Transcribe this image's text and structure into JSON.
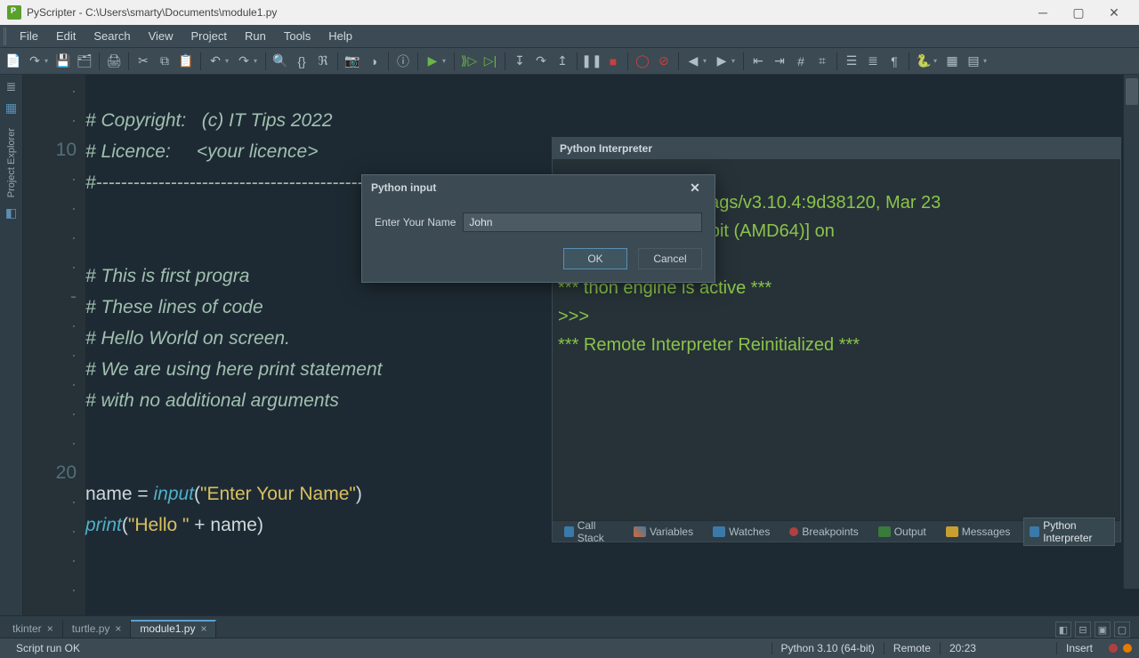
{
  "title": "PyScripter - C:\\Users\\smarty\\Documents\\module1.py",
  "menu": [
    "File",
    "Edit",
    "Search",
    "View",
    "Project",
    "Run",
    "Tools",
    "Help"
  ],
  "gutter": [
    "·",
    "·",
    "10",
    "·",
    "·",
    "·",
    "·",
    "-",
    "·",
    "·",
    "·",
    "·",
    "·",
    "20",
    "·",
    "·",
    "·",
    "·"
  ],
  "code": {
    "l1": "# Copyright:   (c) IT Tips 2022",
    "l2": "# Licence:     <your licence>",
    "l3": "#-------------------------------------------------",
    "l4": "# This is first progra",
    "l5": "# These lines of code",
    "l6": "# Hello World on screen.",
    "l7": "# We are using here print statement",
    "l8": "# with no additional arguments",
    "l9a": "name",
    "l9b": " = ",
    "l9c": "input",
    "l9d": "(",
    "l9e": "\"Enter Your Name\"",
    "l9f": ")",
    "l10a": "print",
    "l10b": "(",
    "l10c": "\"Hello \"",
    "l10d": " + ",
    "l10e": "name",
    "l10f": ")"
  },
  "interpreter": {
    "title": "Python Interpreter",
    "line1": "*** Python 3.10.4 (tags/v3.10.4:9d38120, Mar 23",
    "line2": "1) [MSC v.1929 64 bit (AMD64)] on",
    "line3": "thon engine is active ***",
    "line4": ">>>",
    "line5": "*** Remote Interpreter Reinitialized ***",
    "tabs": [
      "Call Stack",
      "Variables",
      "Watches",
      "Breakpoints",
      "Output",
      "Messages",
      "Python Interpreter"
    ]
  },
  "dialog": {
    "title": "Python input",
    "label": "Enter Your Name",
    "value": "John",
    "ok": "OK",
    "cancel": "Cancel"
  },
  "tabs": [
    {
      "label": "tkinter",
      "active": false
    },
    {
      "label": "turtle.py",
      "active": false
    },
    {
      "label": "module1.py",
      "active": true
    }
  ],
  "status": {
    "left": "Script run OK",
    "python": "Python 3.10 (64-bit)",
    "remote": "Remote",
    "time": "20:23",
    "insert": "Insert"
  }
}
